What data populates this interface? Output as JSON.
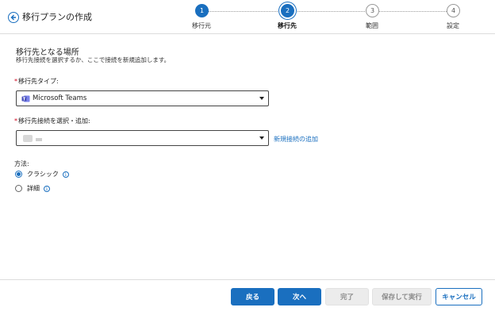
{
  "header": {
    "title": "移行プランの作成",
    "back_icon": "back-arrow-icon",
    "steps": [
      {
        "number": "1",
        "label": "移行元",
        "state": "done"
      },
      {
        "number": "2",
        "label": "移行先",
        "state": "current"
      },
      {
        "number": "3",
        "label": "範囲",
        "state": "todo"
      },
      {
        "number": "4",
        "label": "設定",
        "state": "todo"
      }
    ]
  },
  "main": {
    "section_title": "移行先となる場所",
    "section_desc": "移行先接続を選択するか、ここで接続を新規追加します。",
    "type_field": {
      "required_mark": "*",
      "label": "移行先タイプ:",
      "value": "Microsoft Teams",
      "icon": "teams-icon"
    },
    "connection_field": {
      "required_mark": "*",
      "label": "移行先接続を選択・追加:",
      "value": "",
      "add_link": "新規接続の追加"
    },
    "method": {
      "label": "方法:",
      "options": [
        {
          "label": "クラシック",
          "selected": true
        },
        {
          "label": "詳細",
          "selected": false
        }
      ],
      "info_glyph": "i"
    }
  },
  "footer": {
    "back": "戻る",
    "next": "次へ",
    "finish": "完了",
    "save_run": "保存して実行",
    "cancel": "キャンセル"
  },
  "colors": {
    "accent": "#1a6fbf",
    "required": "#d0021b",
    "disabled_bg": "#ececec"
  }
}
